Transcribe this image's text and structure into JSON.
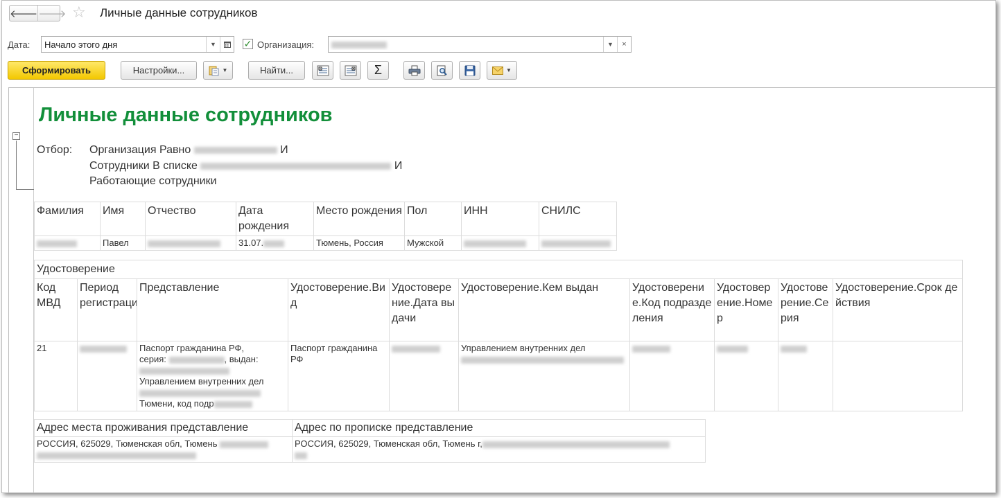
{
  "window": {
    "title": "Личные данные сотрудников",
    "back_glyph": "🡐",
    "forward_glyph": "🡒",
    "star_glyph": "☆"
  },
  "params": {
    "date_label": "Дата:",
    "date_value": "Начало этого дня",
    "org_label": "Организация:",
    "org_checked": true
  },
  "toolbar": {
    "generate": "Сформировать",
    "settings": "Настройки...",
    "find": "Найти...",
    "sum_glyph": "Σ"
  },
  "report": {
    "title": "Личные данные сотрудников",
    "filter_label": "Отбор:",
    "filter_line1_prefix": "Организация Равно",
    "filter_line1_suffix": "И",
    "filter_line2_prefix": "Сотрудники В списке",
    "filter_line2_suffix": "И",
    "filter_line3": "Работающие сотрудники",
    "person_table": {
      "headers": [
        "Фамилия",
        "Имя",
        "Отчество",
        "Дата рождения",
        "Место рождения",
        "Пол",
        "ИНН",
        "СНИЛС"
      ],
      "row": {
        "first_name": "Павел",
        "birth_date_prefix": "31.07.",
        "birth_place": "Тюмень, Россия",
        "gender": "Мужской"
      }
    },
    "id_table": {
      "group_header": "Удостоверение",
      "headers": [
        "Код МВД",
        "Период регистрации",
        "Представление",
        "Удостоверение.Вид",
        "Удостоверение.Дата выдачи",
        "Удостоверение.Кем выдан",
        "Удостоверение.Код подразделения",
        "Удостоверение.Номер",
        "Удостоверение.Серия",
        "Удостоверение.Срок действия"
      ],
      "row": {
        "code": "21",
        "repr_line1": "Паспорт гражданина РФ,",
        "repr_line2": "серия:",
        "repr_line2b": ", выдан:",
        "repr_line4": "Управлением внутренних дел",
        "repr_line6": "Тюмени, код подр",
        "kind": "Паспорт гражданина РФ",
        "issued_by": "Управлением внутренних дел"
      }
    },
    "address_table": {
      "headers": [
        "Адрес места проживания представление",
        "Адрес по прописке представление"
      ],
      "residence": "РОССИЯ, 625029, Тюменская обл, Тюмень",
      "registration": "РОССИЯ, 625029, Тюменская обл, Тюмень г,"
    }
  }
}
